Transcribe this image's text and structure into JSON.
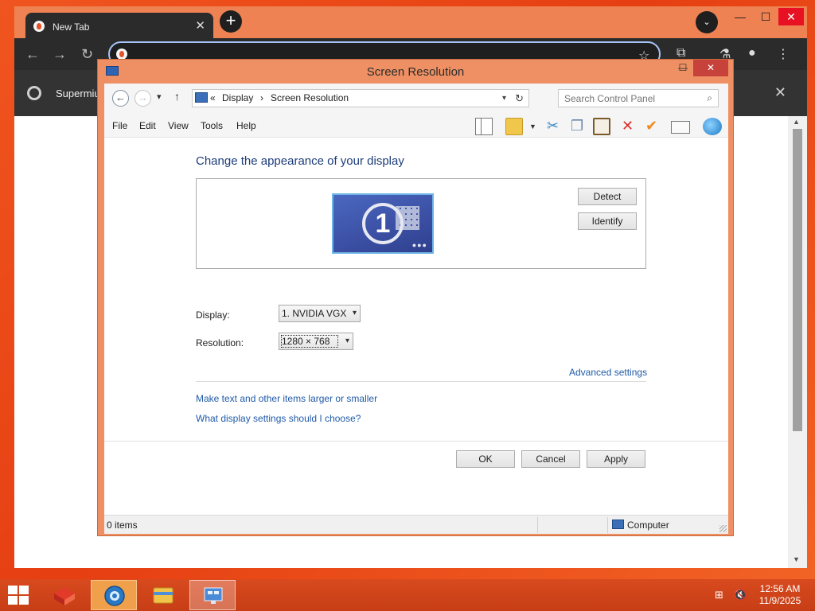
{
  "browser": {
    "tab_title": "New Tab",
    "tab_close": "✕",
    "new_tab_symbol": "+",
    "tab_search_symbol": "⌄",
    "window_controls": {
      "minimize": "—",
      "maximize": "☐",
      "close": "✕"
    },
    "infobar_label": "Supermiu",
    "infobar_close": "✕"
  },
  "window": {
    "title": "Screen Resolution",
    "controls": {
      "minimize": "—",
      "maximize": "☐",
      "close": "✕"
    },
    "breadcrumb": {
      "prefix": "«",
      "items": [
        "Display",
        "Screen Resolution"
      ],
      "separator": "›"
    },
    "search_placeholder": "Search Control Panel",
    "menu": [
      "File",
      "Edit",
      "View",
      "Tools",
      "Help"
    ]
  },
  "content": {
    "heading": "Change the appearance of your display",
    "monitor_number": "1",
    "detect_label": "Detect",
    "identify_label": "Identify",
    "display_label": "Display:",
    "display_value": "1. NVIDIA VGX",
    "resolution_label": "Resolution:",
    "resolution_value": "1280 × 768",
    "advanced_link": "Advanced settings",
    "link_text_size": "Make text and other items larger or smaller",
    "link_help": "What display settings should I choose?",
    "ok_label": "OK",
    "cancel_label": "Cancel",
    "apply_label": "Apply"
  },
  "statusbar": {
    "items_count": "0 items",
    "location": "Computer"
  },
  "taskbar": {
    "time": "12:56 AM",
    "date": "11/9/2025"
  },
  "colors": {
    "desktop": "#e8471a",
    "window_frame": "#ee9063",
    "link": "#1f5aa8",
    "heading": "#1d3d7a",
    "close_red": "#c7423b"
  }
}
